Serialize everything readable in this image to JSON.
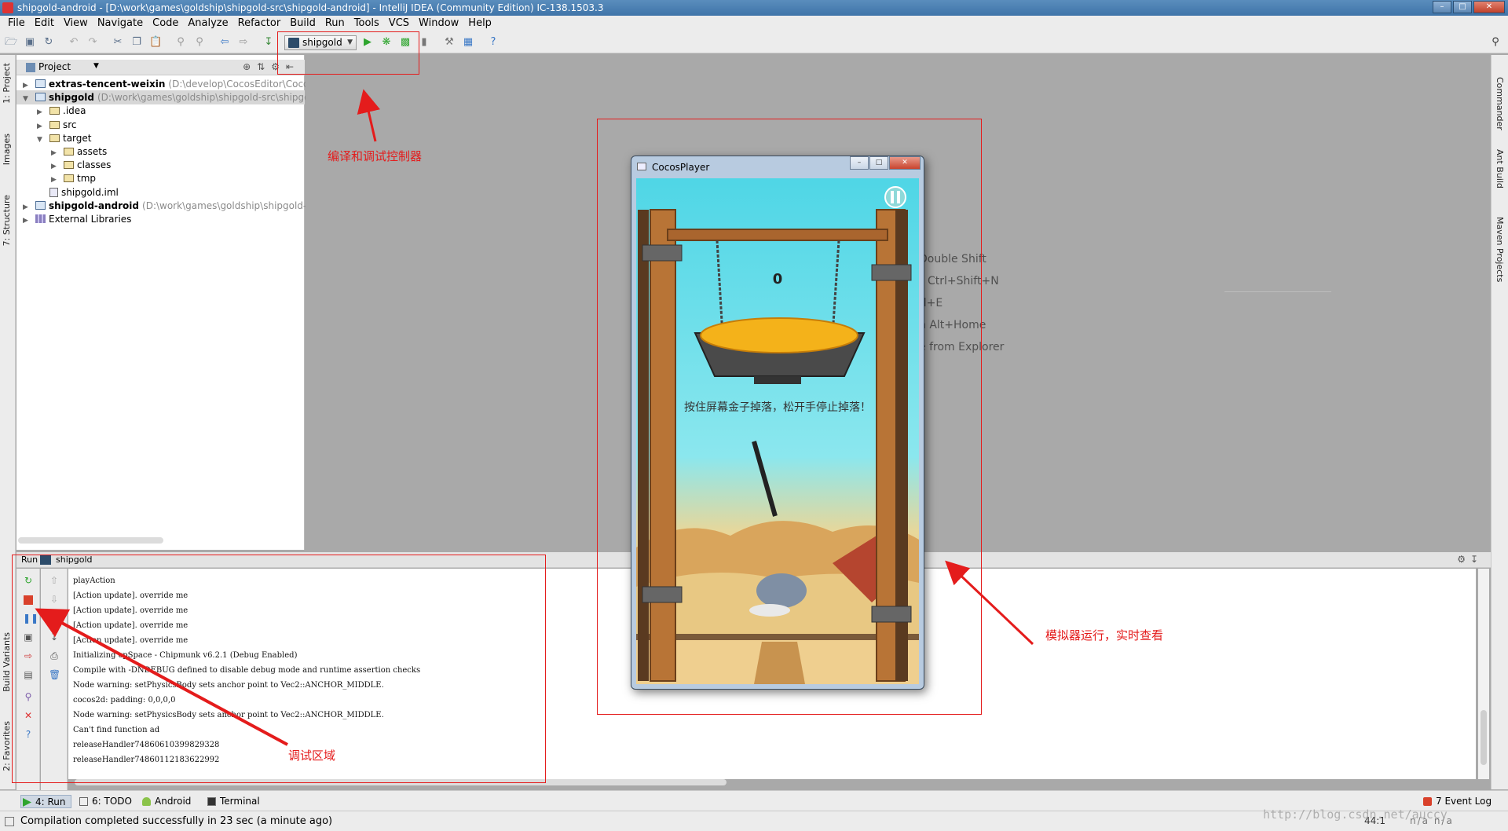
{
  "window": {
    "title": "shipgold-android - [D:\\work\\games\\goldship\\shipgold-src\\shipgold-android] - IntelliJ IDEA (Community Edition) IC-138.1503.3"
  },
  "menu": [
    "File",
    "Edit",
    "View",
    "Navigate",
    "Code",
    "Analyze",
    "Refactor",
    "Build",
    "Run",
    "Tools",
    "VCS",
    "Window",
    "Help"
  ],
  "toolbar": {
    "run_config": "shipgold",
    "icons": [
      "open-icon",
      "save-icon",
      "sync-icon",
      "undo-icon",
      "redo-icon",
      "cut-icon",
      "copy-icon",
      "paste-icon",
      "find-icon",
      "replace-icon",
      "back-icon",
      "forward-icon",
      "make-icon",
      "run-icon",
      "debug-icon",
      "coverage-icon",
      "stop-icon",
      "settings-icon",
      "structure-icon",
      "help-icon",
      "search-everywhere-icon"
    ]
  },
  "left_tool_tabs": [
    "1: Project",
    "Images",
    "7: Structure",
    "Build Variants",
    "2: Favorites"
  ],
  "right_tool_tabs": [
    "Commander",
    "Ant Build",
    "Maven Projects"
  ],
  "project": {
    "header_title": "Project",
    "tree": [
      {
        "name": "extras-tencent-weixin",
        "path": "(D:\\develop\\CocosEditor\\Cocos",
        "bold": true,
        "type": "module",
        "indent": 0,
        "expanded": false
      },
      {
        "name": "shipgold",
        "path": "(D:\\work\\games\\goldship\\shipgold-src\\shipgo",
        "bold": true,
        "type": "module",
        "indent": 0,
        "expanded": true,
        "selected": true
      },
      {
        "name": ".idea",
        "type": "folder",
        "indent": 1,
        "expanded": false
      },
      {
        "name": "src",
        "type": "folder",
        "indent": 1,
        "expanded": false
      },
      {
        "name": "target",
        "type": "folder",
        "indent": 1,
        "expanded": true
      },
      {
        "name": "assets",
        "type": "folder",
        "indent": 2,
        "expanded": false
      },
      {
        "name": "classes",
        "type": "folder",
        "indent": 2,
        "expanded": false
      },
      {
        "name": "tmp",
        "type": "folder",
        "indent": 2,
        "expanded": false
      },
      {
        "name": "shipgold.iml",
        "type": "file",
        "indent": 1
      },
      {
        "name": "shipgold-android",
        "path": "(D:\\work\\games\\goldship\\shipgold-",
        "bold": true,
        "type": "module",
        "indent": 0,
        "expanded": false
      },
      {
        "name": "External Libraries",
        "type": "libs",
        "indent": 0,
        "expanded": false
      }
    ]
  },
  "editor_hints": [
    "Double Shift",
    "Ctrl+Shift+N",
    "rl+E",
    "h Alt+Home",
    "e from Explorer"
  ],
  "run_panel": {
    "label": "Run",
    "config_name": "shipgold",
    "console_lines": [
      "playAction",
      "[Action update]. override me",
      "[Action update]. override me",
      "[Action update]. override me",
      "[Action update]. override me",
      "Initializing cpSpace - Chipmunk v6.2.1 (Debug Enabled)",
      "Compile with -DNDEBUG defined to disable debug mode and runtime assertion checks",
      "Node warning: setPhysicsBody sets anchor point to Vec2::ANCHOR_MIDDLE.",
      "cocos2d: padding: 0,0,0,0",
      "Node warning: setPhysicsBody sets anchor point to Vec2::ANCHOR_MIDDLE.",
      "Can't find function ad",
      "releaseHandler74860610399829328",
      "releaseHandler74860112183622992"
    ]
  },
  "bottom_tabs": [
    {
      "label": "4: Run",
      "active": true,
      "icon": "run-icon"
    },
    {
      "label": "6: TODO",
      "active": false,
      "icon": "todo-icon"
    },
    {
      "label": "Android",
      "active": false,
      "icon": "android-icon"
    },
    {
      "label": "Terminal",
      "active": false,
      "icon": "terminal-icon"
    }
  ],
  "event_log": "7 Event Log",
  "status": {
    "message": "Compilation completed successfully in 23 sec (a minute ago)",
    "position": "44:1",
    "right_items": "n/a  n/a"
  },
  "cocos_player": {
    "title": "CocosPlayer",
    "score": "0",
    "instruction": "按住屏幕金子掉落，松开手停止掉落！"
  },
  "annotations": {
    "toolbar_note": "编译和调试控制器",
    "simulator_note": "模拟器运行，实时查看",
    "debug_note": "调试区域"
  },
  "watermark": "http://blog.csdn.net/auccy",
  "colors": {
    "annotation_red": "#e41c1c",
    "title_bar": "#4a7fb2",
    "run_green": "#2fa52f",
    "stop_red": "#d9412b"
  }
}
